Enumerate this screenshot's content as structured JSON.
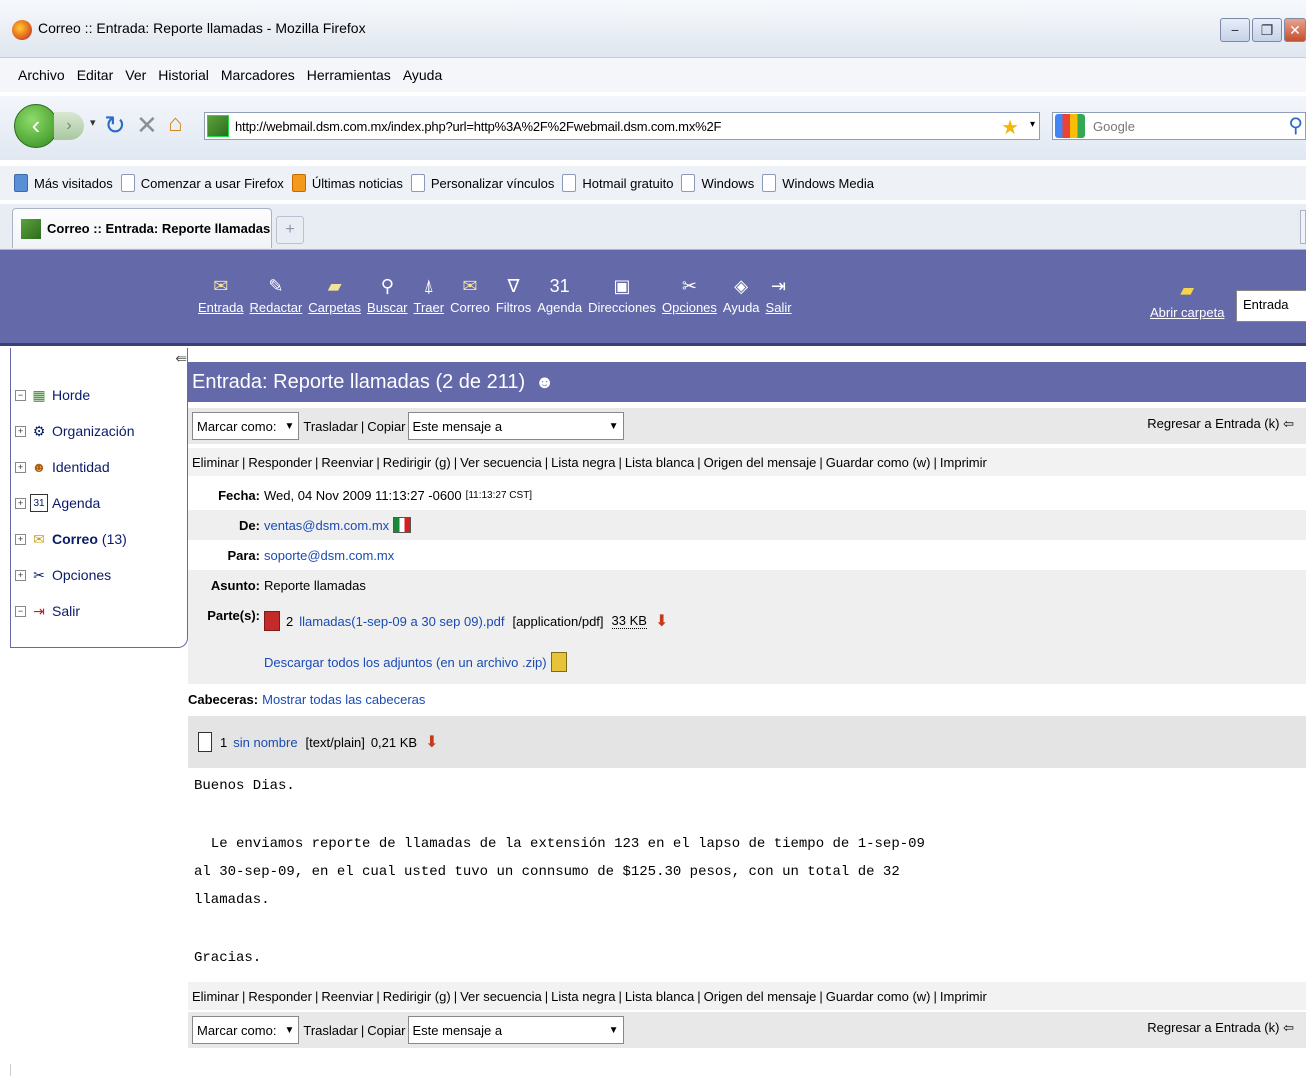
{
  "window": {
    "title": "Correo :: Entrada: Reporte llamadas - Mozilla Firefox",
    "controls": [
      "−",
      "❐",
      "✕"
    ]
  },
  "menubar": [
    "Archivo",
    "Editar",
    "Ver",
    "Historial",
    "Marcadores",
    "Herramientas",
    "Ayuda"
  ],
  "navbar": {
    "url": "http://webmail.dsm.com.mx/index.php?url=http%3A%2F%2Fwebmail.dsm.com.mx%2F",
    "search_placeholder": "Google"
  },
  "bookmarks": [
    {
      "label": "Más visitados",
      "icon": "most-visited-icon"
    },
    {
      "label": "Comenzar a usar Firefox",
      "icon": "page-icon"
    },
    {
      "label": "Últimas noticias",
      "icon": "rss-icon"
    },
    {
      "label": "Personalizar vínculos",
      "icon": "page-icon"
    },
    {
      "label": "Hotmail gratuito",
      "icon": "page-icon"
    },
    {
      "label": "Windows",
      "icon": "page-icon"
    },
    {
      "label": "Windows Media",
      "icon": "page-icon"
    }
  ],
  "tab": {
    "label": "Correo :: Entrada: Reporte llamadas",
    "new_tab_symbol": "+"
  },
  "horde_toolbar": {
    "items": [
      {
        "label": "Entrada",
        "icon": "✉"
      },
      {
        "label": "Redactar",
        "icon": "✎"
      },
      {
        "label": "Carpetas",
        "icon": "▰"
      },
      {
        "label": "Buscar",
        "icon": "⚲"
      },
      {
        "label": "Traer",
        "icon": "⍋"
      },
      {
        "label": "Correo",
        "icon": "✉"
      },
      {
        "label": "Filtros",
        "icon": "∇"
      },
      {
        "label": "Agenda",
        "icon": "31"
      },
      {
        "label": "Direcciones",
        "icon": "▣"
      },
      {
        "label": "Opciones",
        "icon": "✂"
      },
      {
        "label": "Ayuda",
        "icon": "◈"
      },
      {
        "label": "Salir",
        "icon": "⇥"
      }
    ],
    "open_folder_label": "Abrir carpeta",
    "folder_select_value": "Entrada"
  },
  "sidebar": {
    "items": [
      {
        "expander": "−",
        "label": "Horde",
        "icon": "▦"
      },
      {
        "expander": "+",
        "label": "Organización",
        "icon": "⚙"
      },
      {
        "expander": "+",
        "label": "Identidad",
        "icon": "☻"
      },
      {
        "expander": "+",
        "label": "Agenda",
        "icon": "31"
      },
      {
        "expander": "+",
        "label": "Correo",
        "count": "(13)",
        "icon": "✉"
      },
      {
        "expander": "+",
        "label": "Opciones",
        "icon": "✂"
      },
      {
        "expander": "−",
        "label": "Salir",
        "icon": "⇥"
      }
    ]
  },
  "message": {
    "heading": "Entrada: Reporte llamadas (2 de 211)",
    "mark_as": "Marcar como:",
    "move": "Trasladar",
    "copy": "Copiar",
    "target_select": "Este mensaje a",
    "back_link": "Regresar a Entrada (k)",
    "actions": [
      "Eliminar",
      "Responder",
      "Reenviar",
      "Redirigir (g)",
      "Ver secuencia",
      "Lista negra",
      "Lista blanca",
      "Origen del mensaje",
      "Guardar como (w)",
      "Imprimir"
    ],
    "headers": {
      "date_label": "Fecha:",
      "date_value": "Wed, 04 Nov 2009 11:13:27 -0600",
      "date_local": "[11:13:27 CST]",
      "from_label": "De:",
      "from_value": "ventas@dsm.com.mx",
      "to_label": "Para:",
      "to_value": "soporte@dsm.com.mx",
      "subject_label": "Asunto:",
      "subject_value": "Reporte llamadas",
      "parts_label": "Parte(s):",
      "part_number": "2",
      "part_name": "llamadas(1-sep-09 a 30 sep 09).pdf",
      "part_type": "[application/pdf]",
      "part_size": "33 KB",
      "download_all": "Descargar todos los adjuntos (en un archivo .zip)",
      "headers_label": "Cabeceras:",
      "show_all_headers": "Mostrar todas las cabeceras"
    },
    "body_part": {
      "number": "1",
      "name": "sin nombre",
      "type": "[text/plain]",
      "size": "0,21 KB"
    },
    "body": {
      "line1": "Buenos Dias.",
      "line2": "  Le enviamos reporte de llamadas de la extensión 123 en el lapso de tiempo de 1-sep-09",
      "line3": "al 30-sep-09, en el cual usted tuvo un connsumo de $125.30 pesos, con un total de 32",
      "line4": "llamadas.",
      "line5": "Gracias."
    }
  }
}
